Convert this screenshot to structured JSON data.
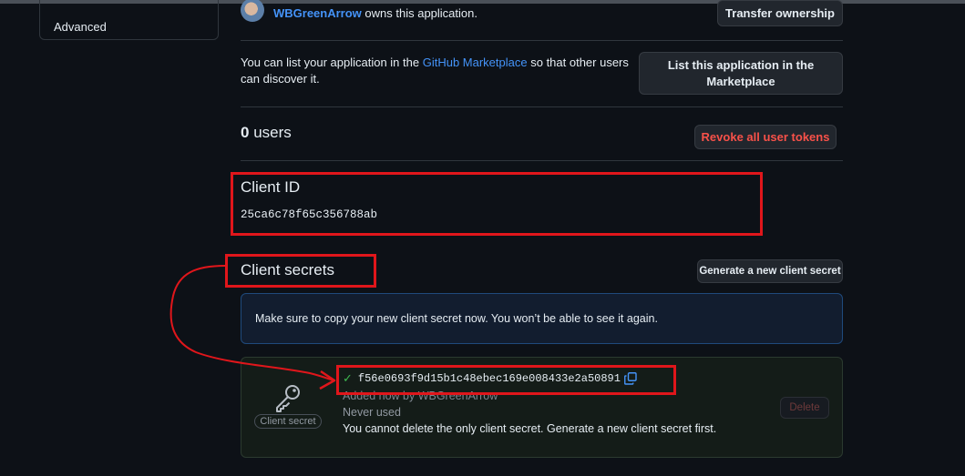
{
  "sidebar": {
    "items": [
      {
        "label": "Advanced"
      }
    ]
  },
  "owner": {
    "name": "WBGreenArrow",
    "suffix": " owns this application.",
    "transfer_label": "Transfer ownership"
  },
  "marketplace": {
    "text_before": "You can list your application in the ",
    "link": "GitHub Marketplace",
    "text_after": " so that other users can discover it.",
    "button_label": "List this application in the Marketplace"
  },
  "users": {
    "count": "0",
    "label": " users",
    "revoke_label": "Revoke all user tokens"
  },
  "client_id": {
    "heading": "Client ID",
    "value": "25ca6c78f65c356788ab"
  },
  "client_secrets": {
    "heading": "Client secrets",
    "generate_label": "Generate a new client secret",
    "flash": "Make sure to copy your new client secret now. You won’t be able to see it again.",
    "secret": {
      "icon_label": "Client secret",
      "value": "f56e0693f9d15b1c48ebec169e008433e2a50891",
      "added": "Added now by WBGreenArrow",
      "usage": "Never used",
      "note": "You cannot delete the only client secret. Generate a new client secret first.",
      "delete_label": "Delete"
    }
  },
  "colors": {
    "background": "#0d1117",
    "link": "#4493f8",
    "annotation": "#e0161b",
    "success": "#3fb950",
    "danger": "#f85149"
  },
  "icons": [
    "avatar",
    "check-icon",
    "copy-icon",
    "key-icon"
  ]
}
